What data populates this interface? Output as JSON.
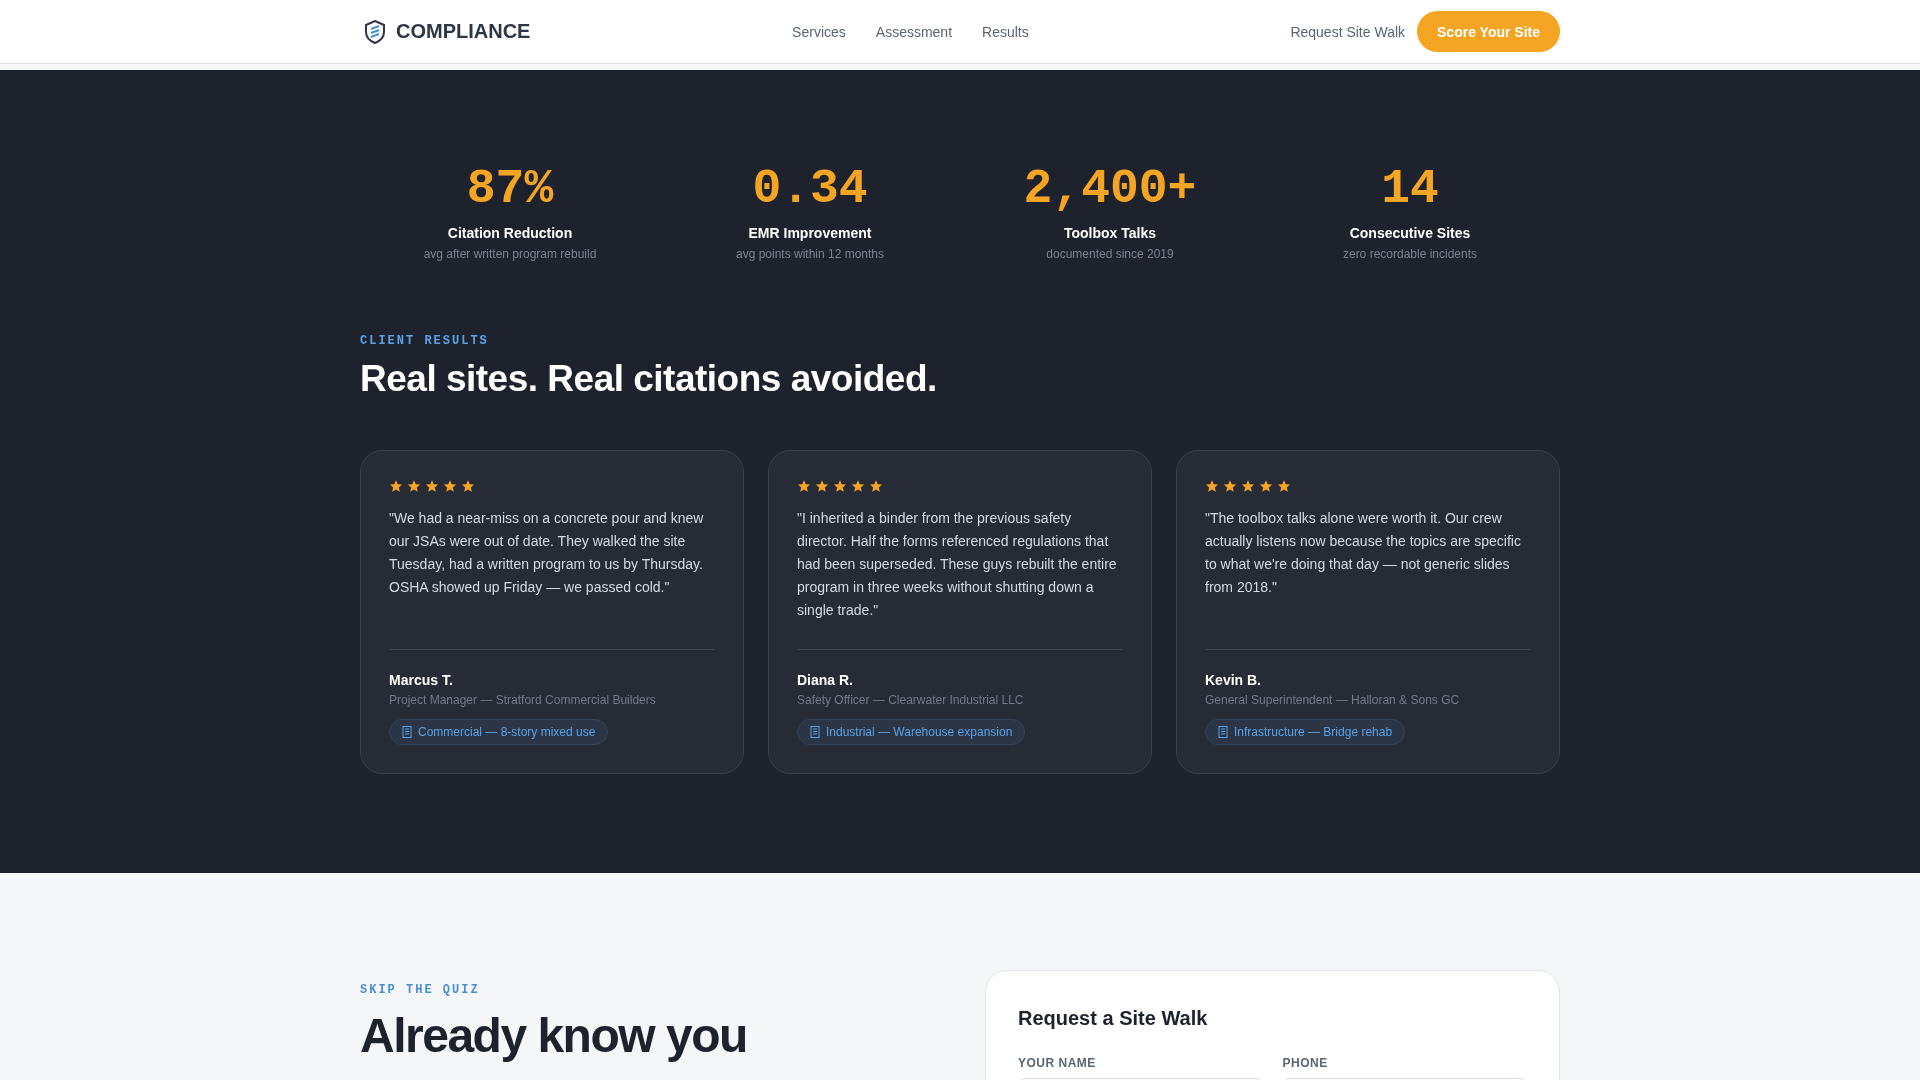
{
  "header": {
    "brand": "COMPLIANCE",
    "nav": [
      {
        "label": "Services"
      },
      {
        "label": "Assessment"
      },
      {
        "label": "Results"
      }
    ],
    "secondary_link": "Request Site Walk",
    "cta": "Score Your Site"
  },
  "stats": [
    {
      "value": "87%",
      "label": "Citation Reduction",
      "sub": "avg after written program rebuild"
    },
    {
      "value": "0.34",
      "label": "EMR Improvement",
      "sub": "avg points within 12 months"
    },
    {
      "value": "2,400+",
      "label": "Toolbox Talks",
      "sub": "documented since 2019"
    },
    {
      "value": "14",
      "label": "Consecutive Sites",
      "sub": "zero recordable incidents"
    }
  ],
  "results": {
    "eyebrow": "CLIENT RESULTS",
    "heading": "Real sites. Real citations avoided.",
    "testimonials": [
      {
        "stars": 5,
        "quote": "\"We had a near-miss on a concrete pour and knew our JSAs were out of date. They walked the site Tuesday, had a written program to us by Thursday. OSHA showed up Friday — we passed cold.\"",
        "name": "Marcus T.",
        "role": "Project Manager — Stratford Commercial Builders",
        "tag": "Commercial — 8-story mixed use"
      },
      {
        "stars": 5,
        "quote": "\"I inherited a binder from the previous safety director. Half the forms referenced regulations that had been superseded. These guys rebuilt the entire program in three weeks without shutting down a single trade.\"",
        "name": "Diana R.",
        "role": "Safety Officer — Clearwater Industrial LLC",
        "tag": "Industrial — Warehouse expansion"
      },
      {
        "stars": 5,
        "quote": "\"The toolbox talks alone were worth it. Our crew actually listens now because the topics are specific to what we're doing that day — not generic slides from 2018.\"",
        "name": "Kevin B.",
        "role": "General Superintendent — Halloran & Sons GC",
        "tag": "Infrastructure — Bridge rehab"
      }
    ]
  },
  "walk": {
    "eyebrow": "SKIP THE QUIZ",
    "heading_dark": "Already know you",
    "form": {
      "title": "Request a Site Walk",
      "fields": [
        {
          "label": "YOUR NAME"
        },
        {
          "label": "PHONE"
        }
      ]
    }
  }
}
